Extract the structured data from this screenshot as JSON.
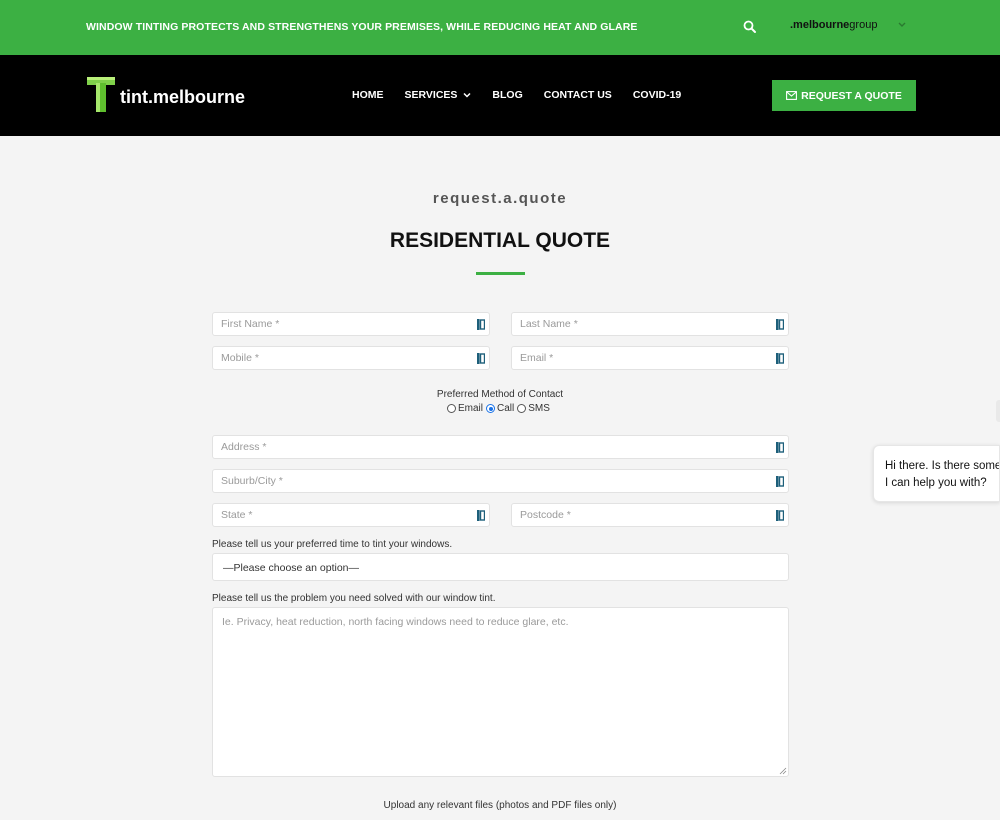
{
  "topbar": {
    "tagline": "WINDOW TINTING PROTECTS AND STRENGTHENS YOUR PREMISES, WHILE REDUCING HEAT AND GLARE",
    "group_brand_bold": ".melbourne",
    "group_brand_light": "group"
  },
  "header": {
    "logo_text": "tint.melbourne",
    "nav": [
      {
        "label": "HOME"
      },
      {
        "label": "SERVICES"
      },
      {
        "label": "BLOG"
      },
      {
        "label": "CONTACT US"
      },
      {
        "label": "COVID-19"
      }
    ],
    "cta_label": "REQUEST A QUOTE"
  },
  "page": {
    "subtitle": "request.a.quote",
    "title": "RESIDENTIAL QUOTE"
  },
  "form": {
    "first_name_placeholder": "First Name *",
    "last_name_placeholder": "Last Name *",
    "mobile_placeholder": "Mobile *",
    "email_placeholder": "Email *",
    "contact_method_label": "Preferred Method of Contact",
    "contact_options": [
      {
        "label": "Email",
        "selected": false
      },
      {
        "label": "Call",
        "selected": true
      },
      {
        "label": "SMS",
        "selected": false
      }
    ],
    "address_placeholder": "Address *",
    "suburb_placeholder": "Suburb/City *",
    "state_placeholder": "State *",
    "postcode_placeholder": "Postcode *",
    "time_label": "Please tell us your preferred time to tint your windows.",
    "time_select_value": "—Please choose an option—",
    "problem_label": "Please tell us the problem you need solved with our window tint.",
    "problem_placeholder": "Ie. Privacy, heat reduction, north facing windows need to reduce glare, etc.",
    "upload_label": "Upload any relevant files (photos and PDF files only)"
  },
  "chat": {
    "line1": "Hi there. Is there some",
    "line2": "I can help you with?"
  },
  "colors": {
    "brand_green": "#3cb043",
    "nav_black": "#000000",
    "page_bg": "#f4f4f4"
  }
}
